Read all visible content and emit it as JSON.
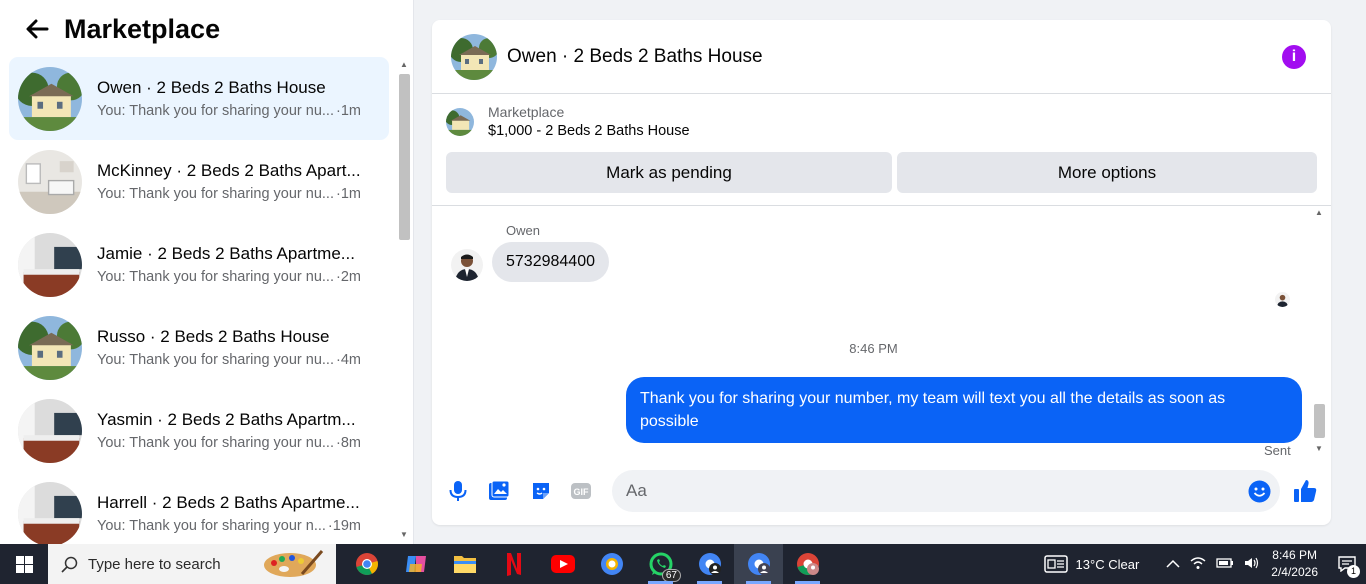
{
  "sidebar": {
    "title": "Marketplace",
    "conversations": [
      {
        "title": "Owen · 2 Beds 2 Baths House",
        "preview": "You: Thank you for sharing your nu...",
        "time": "·1m",
        "thumb": "house"
      },
      {
        "title": "McKinney · 2 Beds 2 Baths Apart...",
        "preview": "You: Thank you for sharing your nu...",
        "time": "·1m",
        "thumb": "room-white"
      },
      {
        "title": "Jamie · 2 Beds 2 Baths Apartme...",
        "preview": "You: Thank you for sharing your nu...",
        "time": "·2m",
        "thumb": "room-bed"
      },
      {
        "title": "Russo · 2 Beds 2 Baths House",
        "preview": "You: Thank you for sharing your nu...",
        "time": "·4m",
        "thumb": "house"
      },
      {
        "title": "Yasmin · 2 Beds 2 Baths Apartm...",
        "preview": "You: Thank you for sharing your nu...",
        "time": "·8m",
        "thumb": "room-bed"
      },
      {
        "title": "Harrell · 2 Beds 2 Baths Apartme...",
        "preview": "You: Thank you for sharing your n...",
        "time": "·19m",
        "thumb": "room-bed"
      }
    ]
  },
  "chat": {
    "title": "Owen · 2 Beds 2 Baths House",
    "listing_label": "Marketplace",
    "listing_price": "$1,000 - 2 Beds 2 Baths House",
    "mark_pending": "Mark as pending",
    "more_options": "More options",
    "sender_name": "Owen",
    "incoming_message": "5732984400",
    "time_separator": "8:46 PM",
    "outgoing_message": "Thank you for  sharing your number, my team will text you all the details as soon as possible",
    "sent_status": "Sent",
    "input_placeholder": "Aa",
    "colors": {
      "accent": "#0a63f6",
      "info": "#a20df0"
    }
  },
  "taskbar": {
    "search_placeholder": "Type here to search",
    "whatsapp_badge": "67",
    "weather": "13°C  Clear",
    "time": "8:46 PM",
    "date": "2/4/2026",
    "notification_count": "1"
  }
}
